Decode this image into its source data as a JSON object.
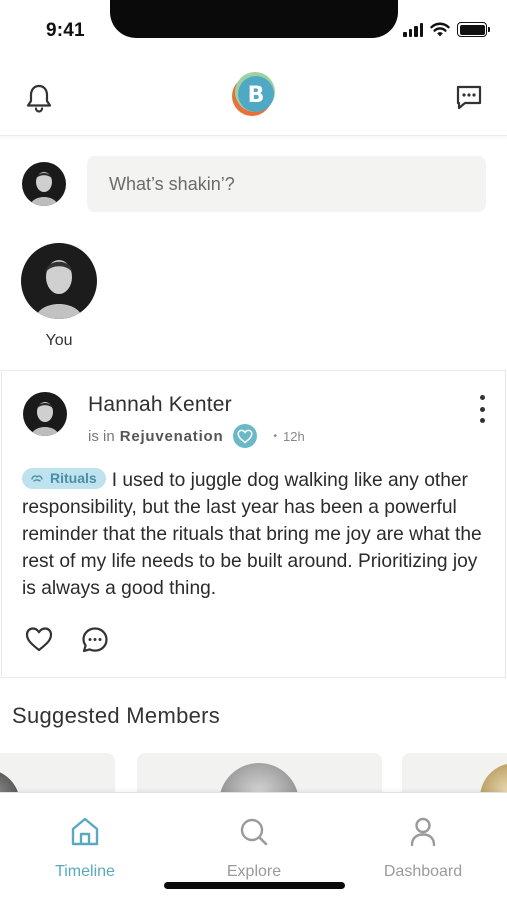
{
  "status_bar": {
    "time": "9:41",
    "icons": [
      "signal-icon",
      "wifi-icon",
      "battery-icon"
    ]
  },
  "top_nav": {
    "left_icon": "bell-icon",
    "right_icon": "message-icon",
    "logo_letter": "B"
  },
  "composer": {
    "placeholder": "What’s shakin’?"
  },
  "stories": [
    {
      "label": "You"
    }
  ],
  "post": {
    "author": "Hannah Kenter",
    "meta_prefix": "is in",
    "group": "Rejuvenation",
    "dot": "•",
    "time_ago": "12h",
    "tag": "Rituals",
    "text": "I used to juggle dog walking like any other responsibility, but the last year has been a powerful reminder that the rituals that bring me joy are what the rest of my life needs to be built around. Prioritizing joy is always a good thing."
  },
  "suggested": {
    "title": "Suggested Members"
  },
  "tabs": [
    {
      "label": "Timeline",
      "icon": "home-icon",
      "active": true
    },
    {
      "label": "Explore",
      "icon": "search-icon",
      "active": false
    },
    {
      "label": "Dashboard",
      "icon": "profile-icon",
      "active": false
    }
  ],
  "colors": {
    "accent": "#5aa9bf",
    "tag_background": "#bfe3ee",
    "tag_text": "#4a8fa6",
    "input_background": "#f3f3f2",
    "inactive_tab": "#9a9a9a"
  }
}
